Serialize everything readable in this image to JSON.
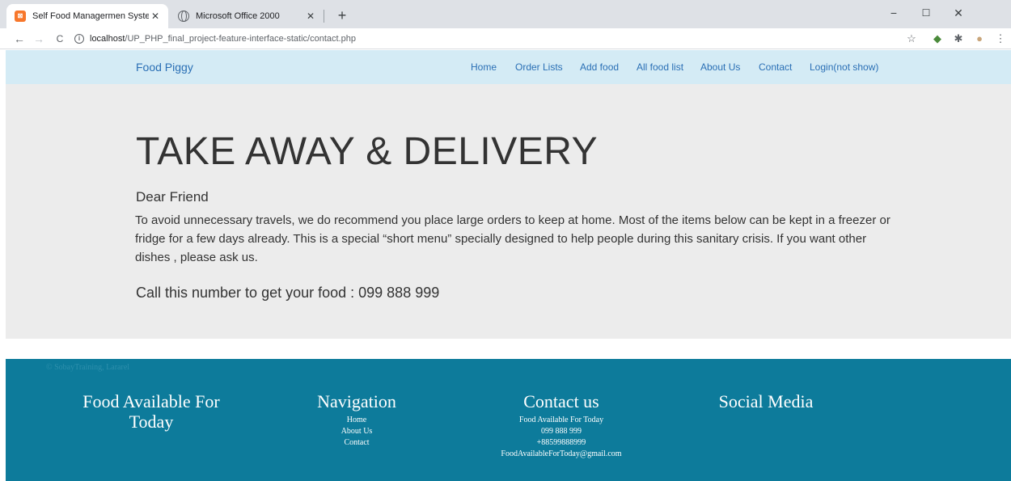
{
  "browser": {
    "tabs": [
      {
        "title": "Self Food Managermen System",
        "close": "✕",
        "favicon": "xampp-icon"
      },
      {
        "title": "Microsoft Office 2000",
        "close": "✕",
        "favicon": "globe-icon"
      }
    ],
    "new_tab": "+",
    "window_controls": {
      "minimize": "−",
      "maximize": "☐",
      "close": "✕"
    },
    "nav": {
      "back": "←",
      "forward": "→",
      "reload": "C"
    },
    "url": {
      "info": "i",
      "host": "localhost",
      "path": "/UP_PHP_final_project-feature-interface-static/contact.php"
    },
    "toolbar_icons": {
      "star": "☆",
      "ext1": "◆",
      "ext2": "✱",
      "profile": "●",
      "menu": "⋮"
    }
  },
  "site": {
    "brand": "Food Piggy",
    "nav": [
      {
        "label": "Home"
      },
      {
        "label": "Order Lists"
      },
      {
        "label": "Add food"
      },
      {
        "label": "All food list"
      },
      {
        "label": "About Us"
      },
      {
        "label": "Contact"
      },
      {
        "label": "Login(not show)"
      }
    ],
    "hero": {
      "title": "TAKE AWAY & DELIVERY",
      "greeting": "Dear Friend",
      "body": "To avoid unnecessary travels, we do recommend you place large orders to keep at home. Most of the items below can be kept in a freezer or fridge for a few days already. This is a special “short menu” specially designed to help people during this sanitary crisis. If you want other dishes , please ask us.",
      "call": "Call this number to get your food : 099 888 999"
    },
    "footer": {
      "copyright": "© SobayTraining, Lararel",
      "col1": {
        "heading": "Food Available For Today"
      },
      "col2": {
        "heading": "Navigation",
        "items": [
          "Home",
          "About Us",
          "Contact"
        ]
      },
      "col3": {
        "heading": "Contact us",
        "items": [
          "Food Available For Today",
          "099 888 999",
          "+88599888999",
          "FoodAvailableForToday@gmail.com"
        ]
      },
      "col4": {
        "heading": "Social Media"
      }
    }
  },
  "colors": {
    "navbar_bg": "#d4ebf5",
    "link": "#2a6fb5",
    "hero_bg": "#ececec",
    "footer_bg": "#0d7b9b"
  }
}
